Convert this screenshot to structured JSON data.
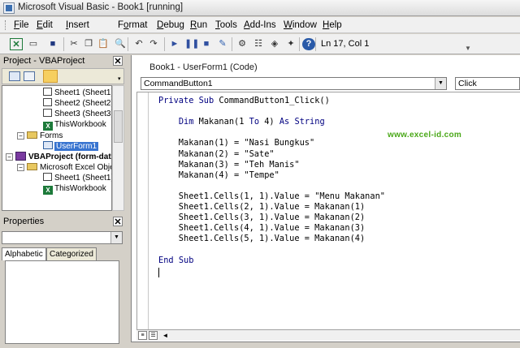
{
  "window": {
    "title": "Microsoft Visual Basic - Book1 [running]"
  },
  "menu": [
    {
      "label": "File",
      "key": "F",
      "rest": "ile"
    },
    {
      "label": "Edit",
      "key": "E",
      "rest": "dit"
    },
    {
      "label": "Insert",
      "key": "I",
      "rest": "nsert"
    },
    {
      "label": "Format",
      "pre": "F",
      "key": "o",
      "rest": "rmat"
    },
    {
      "label": "Debug",
      "key": "D",
      "rest": "ebug"
    },
    {
      "label": "Run",
      "key": "R",
      "rest": "un"
    },
    {
      "label": "Tools",
      "key": "T",
      "rest": "ools"
    },
    {
      "label": "Add-Ins",
      "key": "A",
      "rest": "dd-Ins"
    },
    {
      "label": "Window",
      "key": "W",
      "rest": "indow"
    },
    {
      "label": "Help",
      "key": "H",
      "rest": "elp"
    }
  ],
  "toolbar": {
    "status": "Ln 17, Col 1",
    "icons": [
      "excel-icon",
      "insert-userform-icon",
      "save-icon",
      "cut-icon",
      "copy-icon",
      "paste-icon",
      "find-icon",
      "undo-icon",
      "redo-icon",
      "run-icon",
      "break-icon",
      "reset-icon",
      "design-mode-icon",
      "project-explorer-icon",
      "properties-icon",
      "object-browser-icon",
      "toolbox-icon",
      "help-icon"
    ]
  },
  "project": {
    "title": "Project - VBAProject",
    "tree": [
      {
        "label": "Sheet1 (Sheet1)",
        "kind": "sheet",
        "level": 3
      },
      {
        "label": "Sheet2 (Sheet2)",
        "kind": "sheet",
        "level": 3
      },
      {
        "label": "Sheet3 (Sheet3)",
        "kind": "sheet",
        "level": 3
      },
      {
        "label": "ThisWorkbook",
        "kind": "workbook",
        "level": 3
      },
      {
        "label": "Forms",
        "kind": "folder",
        "level": 2
      },
      {
        "label": "UserForm1",
        "kind": "form",
        "level": 3,
        "selected": true
      },
      {
        "label": "VBAProject (form-dat",
        "kind": "project",
        "level": 1,
        "bold": true
      },
      {
        "label": "Microsoft Excel Objec",
        "kind": "folder",
        "level": 2
      },
      {
        "label": "Sheet1 (Sheet1)",
        "kind": "sheet",
        "level": 3
      },
      {
        "label": "ThisWorkbook",
        "kind": "workbook",
        "level": 3
      }
    ]
  },
  "properties": {
    "title": "Properties",
    "tabs": [
      "Alphabetic",
      "Categorized"
    ]
  },
  "code_window": {
    "title": "Book1 - UserForm1 (Code)",
    "object": "CommandButton1",
    "procedure": "Click",
    "lines": [
      "Private Sub CommandButton1_Click()",
      "",
      "    Dim Makanan(1 To 4) As String",
      "",
      "    Makanan(1) = \"Nasi Bungkus\"",
      "    Makanan(2) = \"Sate\"",
      "    Makanan(3) = \"Teh Manis\"",
      "    Makanan(4) = \"Tempe\"",
      "",
      "    Sheet1.Cells(1, 1).Value = \"Menu Makanan\"",
      "    Sheet1.Cells(2, 1).Value = Makanan(1)",
      "    Sheet1.Cells(3, 1).Value = Makanan(2)",
      "    Sheet1.Cells(4, 1).Value = Makanan(3)",
      "    Sheet1.Cells(5, 1).Value = Makanan(4)",
      "",
      "End Sub"
    ]
  },
  "watermark": "www.excel-id.com"
}
